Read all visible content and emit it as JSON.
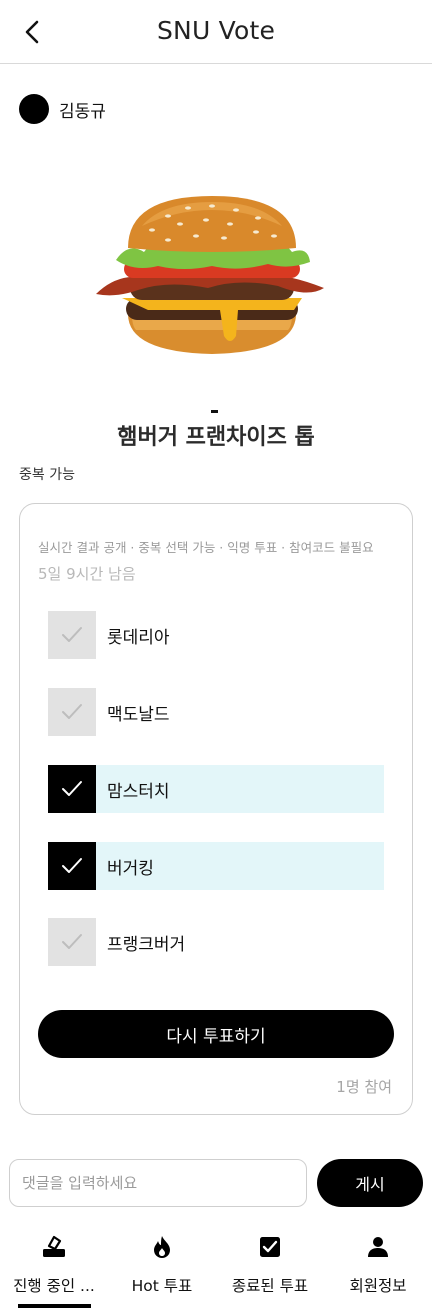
{
  "header": {
    "title": "SNU Vote"
  },
  "author": {
    "name": "김동규"
  },
  "post": {
    "dash": "-",
    "title": "햄버거 프랜차이즈 톱",
    "multi_label": "중복 가능"
  },
  "poll": {
    "meta": "실시간 결과 공개 · 중복 선택 가능 · 익명 투표 · 참여코드 불필요",
    "remaining": "5일 9시간 남음",
    "options": [
      {
        "label": "롯데리아",
        "checked": false
      },
      {
        "label": "맥도날드",
        "checked": false
      },
      {
        "label": "맘스터치",
        "checked": true
      },
      {
        "label": "버거킹",
        "checked": true
      },
      {
        "label": "프랭크버거",
        "checked": false
      }
    ],
    "revote_label": "다시 투표하기",
    "participants": "1명 참여"
  },
  "comment": {
    "placeholder": "댓글을 입력하세요",
    "post_label": "게시"
  },
  "tabs": [
    {
      "label": "진행 중인 ...",
      "icon": "vote-box-icon",
      "active": true
    },
    {
      "label": "Hot 투표",
      "icon": "flame-icon",
      "active": false
    },
    {
      "label": "종료된 투표",
      "icon": "checkbox-icon",
      "active": false
    },
    {
      "label": "회원정보",
      "icon": "person-icon",
      "active": false
    }
  ],
  "colors": {
    "selected_option_bg": "#e3f6f9",
    "unselected_box": "#e2e2e2",
    "primary": "#000000"
  }
}
